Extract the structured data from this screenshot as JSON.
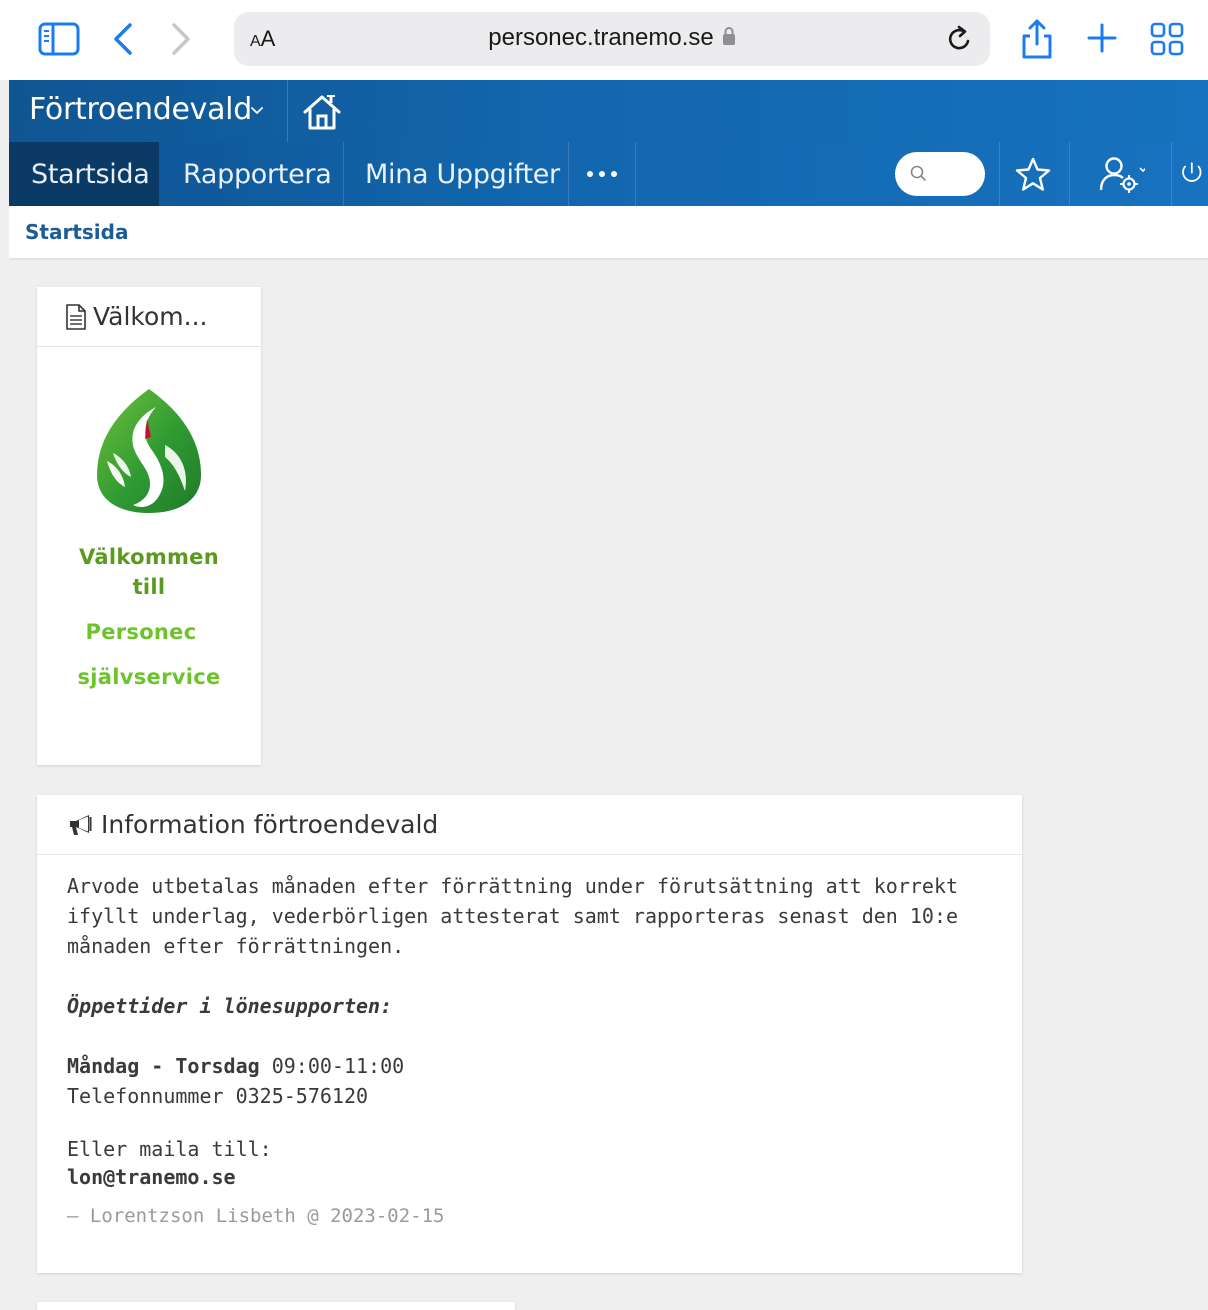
{
  "browser": {
    "aa_small": "A",
    "aa_large": "A",
    "url": "personec.tranemo.se"
  },
  "header": {
    "role": "Förtroendevald"
  },
  "nav": {
    "items": [
      "Startsida",
      "Rapportera",
      "Mina Uppgifter"
    ]
  },
  "breadcrumb": "Startsida",
  "welcome_card": {
    "title": "Välkom...",
    "lines": [
      "Välkommen",
      "till",
      "Personec",
      "självservice"
    ]
  },
  "info_card": {
    "title": "Information förtroendevald",
    "paragraph": "Arvode utbetalas månaden efter förrättning under förutsättning att korrekt ifyllt underlag, vederbörligen attesterat samt rapporteras senast den 10:e månaden efter förrättningen.",
    "hours_heading": "Öppettider i lönesupporten:",
    "days": "Måndag - Torsdag",
    "hours": " 09:00-11:00",
    "phone": "Telefonnummer 0325-576120",
    "mail_prompt": "Eller maila till:",
    "email": "lon@tranemo.se",
    "signature": "— Lorentzson Lisbeth @ 2023-02-15"
  },
  "colors": {
    "nav_blue": "#1366ad",
    "nav_active": "#0b3a66",
    "link_blue": "#1c5d98",
    "brand_green": "#5a9a1f",
    "light_green": "#6cc42a"
  },
  "icons": [
    "sidebar-icon",
    "back-chevron-icon",
    "forward-chevron-icon",
    "lock-icon",
    "reload-icon",
    "share-icon",
    "plus-icon",
    "tabs-grid-icon",
    "home-icon",
    "search-icon",
    "star-icon",
    "user-settings-icon",
    "power-icon",
    "document-icon",
    "megaphone-icon",
    "tranemo-logo"
  ]
}
